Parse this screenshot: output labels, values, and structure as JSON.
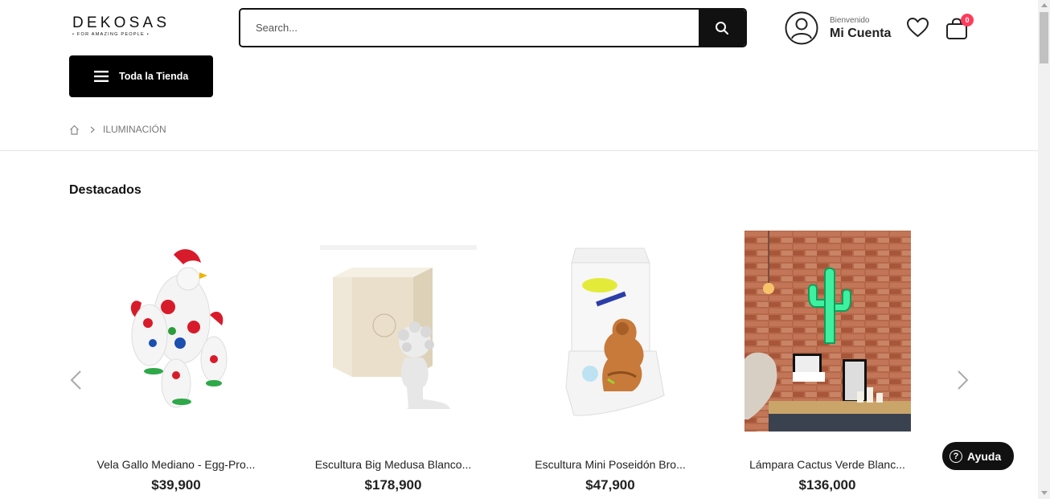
{
  "header": {
    "logo": {
      "name": "DEKOSAS",
      "tagline": "• FOR AMAZING PEOPLE •"
    },
    "search": {
      "placeholder": "Search...",
      "value": ""
    },
    "account": {
      "welcome": "Bienvenido",
      "title": "Mi Cuenta"
    },
    "cart": {
      "count": "0"
    },
    "store_button": {
      "label": "Toda la Tienda"
    }
  },
  "breadcrumb": {
    "current": "ILUMINACIÓN"
  },
  "section": {
    "title": "Destacados"
  },
  "products": [
    {
      "name": "Vela Gallo Mediano - Egg-Pro...",
      "price": "$39,900"
    },
    {
      "name": "Escultura Big Medusa Blanco...",
      "price": "$178,900"
    },
    {
      "name": "Escultura Mini Poseidón Bro...",
      "price": "$47,900"
    },
    {
      "name": "Lámpara Cactus Verde Blanc...",
      "price": "$136,000"
    }
  ],
  "help": {
    "label": "Ayuda"
  },
  "icons": {
    "search": "search-icon",
    "account": "user-icon",
    "wishlist": "heart-icon",
    "cart": "shopping-bag-icon",
    "menu": "hamburger-icon",
    "home": "home-icon",
    "prev": "chevron-left-icon",
    "next": "chevron-right-icon",
    "help": "question-circle-icon"
  },
  "colors": {
    "accent": "#000000",
    "badge": "#ff3b5c"
  }
}
